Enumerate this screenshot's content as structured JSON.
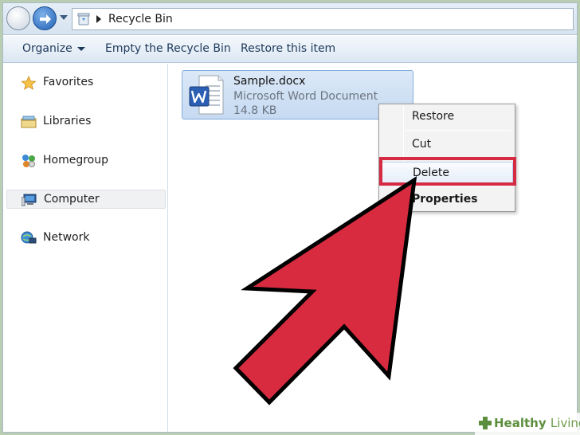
{
  "address_bar": {
    "location": "Recycle Bin",
    "location_icon": "recycle-bin-icon"
  },
  "toolbar": {
    "organize_label": "Organize",
    "empty_label": "Empty the Recycle Bin",
    "restore_label": "Restore this item"
  },
  "sidebar": {
    "items": [
      {
        "label": "Favorites",
        "icon": "star-icon"
      },
      {
        "label": "Libraries",
        "icon": "libraries-icon"
      },
      {
        "label": "Homegroup",
        "icon": "homegroup-icon"
      },
      {
        "label": "Computer",
        "icon": "computer-icon"
      },
      {
        "label": "Network",
        "icon": "network-icon"
      }
    ]
  },
  "file": {
    "name": "Sample.docx",
    "type": "Microsoft Word Document",
    "size": "14.8 KB",
    "icon": "word-document-icon"
  },
  "context_menu": {
    "items": [
      {
        "label": "Restore"
      },
      {
        "label": "Cut"
      },
      {
        "label": "Delete"
      },
      {
        "label": "Properties"
      }
    ]
  },
  "watermark": {
    "brand_bold": "Healthy",
    "brand_thin": "Living"
  },
  "colors": {
    "highlight": "#d62a44",
    "arrow_fill": "#d82b40",
    "selection": "#c6daf2"
  }
}
